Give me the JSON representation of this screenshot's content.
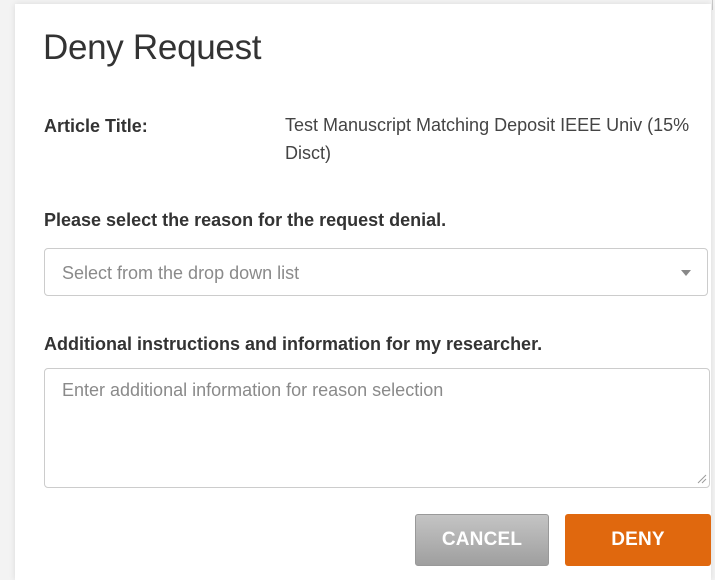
{
  "dialog": {
    "title": "Deny Request",
    "article": {
      "label": "Article Title:",
      "value": "Test Manuscript Matching Deposit IEEE Univ (15% Disct)"
    },
    "reason": {
      "label": "Please select the reason for the request denial.",
      "placeholder": "Select from the drop down list"
    },
    "additional_info": {
      "label": "Additional instructions and information for my researcher.",
      "placeholder": "Enter additional information for reason selection",
      "value": ""
    },
    "buttons": {
      "cancel": "CANCEL",
      "deny": "DENY"
    }
  },
  "colors": {
    "deny_button": "#e0680e",
    "cancel_button": "#b1b1b1",
    "text": "#333333",
    "placeholder": "#8a8a8a"
  },
  "icons": {
    "dropdown": "caret-down-icon",
    "textarea_resize": "resize-grip-icon"
  }
}
